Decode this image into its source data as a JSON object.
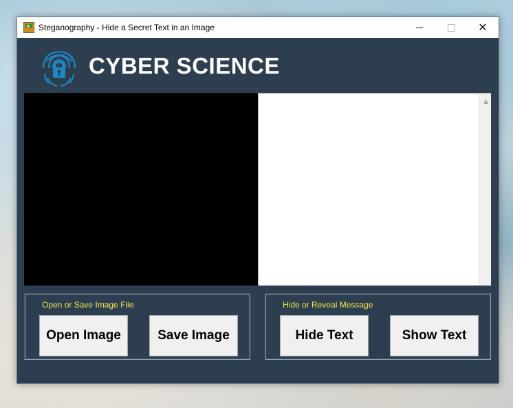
{
  "window": {
    "title": "Steganography - Hide a Secret Text in an Image",
    "app_icon": "landscape-picture-icon",
    "controls": {
      "minimize_icon": "minimize-icon",
      "maximize_icon": "maximize-icon",
      "close_icon": "close-icon",
      "close_glyph": "✕"
    }
  },
  "header": {
    "logo_icon": "fingerprint-lock-icon",
    "brand": "CYBER SCIENCE"
  },
  "panels": {
    "image_preview": {
      "background": "#000000"
    },
    "message_text": {
      "value": ""
    }
  },
  "groups": {
    "file": {
      "label": "Open or Save Image File",
      "open_label": "Open Image",
      "save_label": "Save Image"
    },
    "message": {
      "label": "Hide or Reveal Message",
      "hide_label": "Hide Text",
      "show_label": "Show Text"
    }
  },
  "colors": {
    "window_bg": "#2d3e50",
    "group_label": "#f2e84a",
    "logo": "#1e88c7",
    "button_bg": "#f0f0f0"
  }
}
